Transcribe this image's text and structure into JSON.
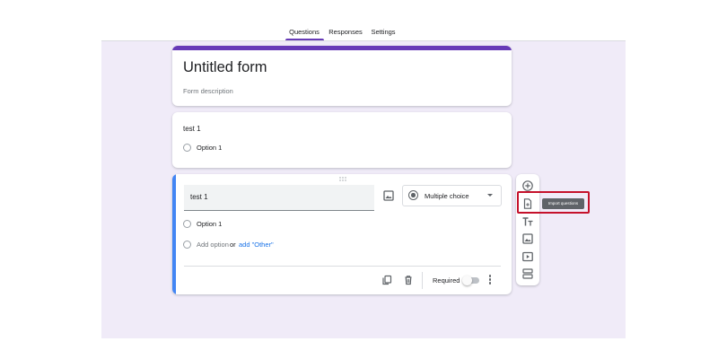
{
  "tabs": [
    {
      "label": "Questions",
      "active": true
    },
    {
      "label": "Responses",
      "active": false
    },
    {
      "label": "Settings",
      "active": false
    }
  ],
  "form": {
    "title": "Untitled form",
    "description_placeholder": "Form description"
  },
  "question_1": {
    "title": "test 1",
    "options": [
      "Option 1"
    ]
  },
  "active_question": {
    "title": "test 1",
    "type": "Multiple choice",
    "options": [
      "Option 1"
    ],
    "add_option": "Add option",
    "or": "or",
    "add_other": "add \"Other\"",
    "required_label": "Required",
    "required": false
  },
  "toolbar": {
    "items": [
      "add-question-icon",
      "import-questions-icon",
      "title-text-icon",
      "image-icon",
      "video-icon",
      "section-icon"
    ],
    "tooltip": "Import questions"
  },
  "colors": {
    "accent": "#673ab7",
    "active_border": "#4285f4",
    "canvas_bg": "#f0ebf8",
    "highlight": "#c5112b",
    "link": "#1a73e8"
  }
}
